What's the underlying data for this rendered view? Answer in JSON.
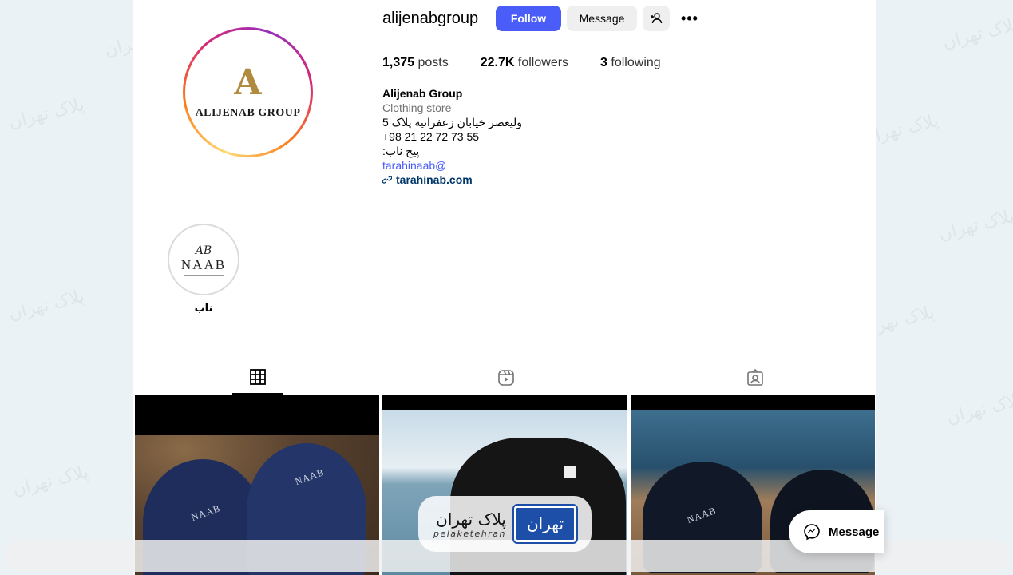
{
  "profile": {
    "username": "alijenabgroup",
    "avatar_brand": "ALIJENAB GROUP",
    "avatar_mark": "A"
  },
  "actions": {
    "follow_label": "Follow",
    "message_label": "Message",
    "more_label": "•••"
  },
  "stats": {
    "posts_count": "1,375",
    "posts_label": "posts",
    "followers_count": "22.7K",
    "followers_label": "followers",
    "following_count": "3",
    "following_label": "following"
  },
  "bio": {
    "name": "Alijenab Group",
    "category": "Clothing store",
    "address": "ولیعصر خیابان زعفرانیه پلاک 5",
    "phone": "+98 21 22 72 73 55",
    "page_note": "پیج ناب:",
    "mention": "tarahinaab@",
    "website": "tarahinab.com"
  },
  "highlights": [
    {
      "monogram": "AB",
      "brand": "NAAB",
      "label": "ناب"
    }
  ],
  "tabs": [
    {
      "name": "posts",
      "icon": "grid-icon",
      "active": true
    },
    {
      "name": "reels",
      "icon": "reels-icon",
      "active": false
    },
    {
      "name": "tagged",
      "icon": "tagged-icon",
      "active": false
    }
  ],
  "posts": [
    {
      "brand_print": "NAAB"
    },
    {
      "brand_print": ""
    },
    {
      "brand_print": "NAAB"
    }
  ],
  "overlay": {
    "plate_fa": "پلاک تهران",
    "plate_en": "pelaketehran",
    "plate_box": "تهران",
    "watermark": "پلاک تهران",
    "floating_message_label": "Message"
  },
  "colors": {
    "follow_button": "#4a5df9",
    "link": "#00376b",
    "plate_blue": "#1d4fa8"
  }
}
